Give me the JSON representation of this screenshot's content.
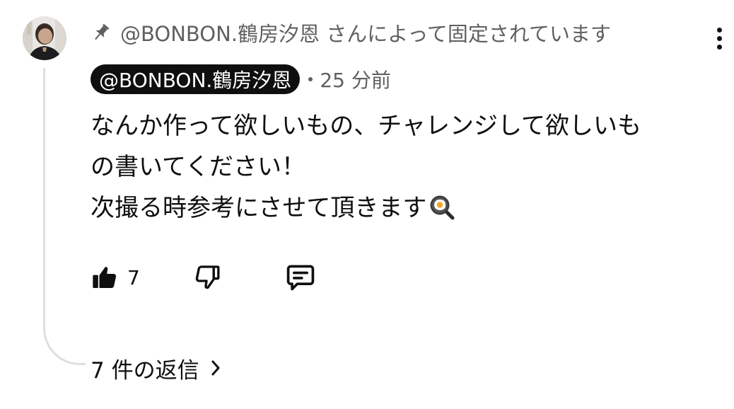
{
  "pinned": {
    "text": "@BONBON.鶴房汐恩 さんによって固定されています",
    "icon": "pin-icon"
  },
  "comment": {
    "author": "@BONBON.鶴房汐恩",
    "timestamp": "25 分前",
    "lines": [
      "なんか作って欲しいもの、チャレンジして欲しいも",
      "の書いてください！",
      "次撮る時参考にさせて頂きます"
    ],
    "emoji": "frying-pan-egg"
  },
  "actions": {
    "like_count": "7",
    "like_icon": "thumbs-up-icon",
    "dislike_icon": "thumbs-down-icon",
    "reply_icon": "comment-icon"
  },
  "replies": {
    "label": "7 件の返信"
  }
}
